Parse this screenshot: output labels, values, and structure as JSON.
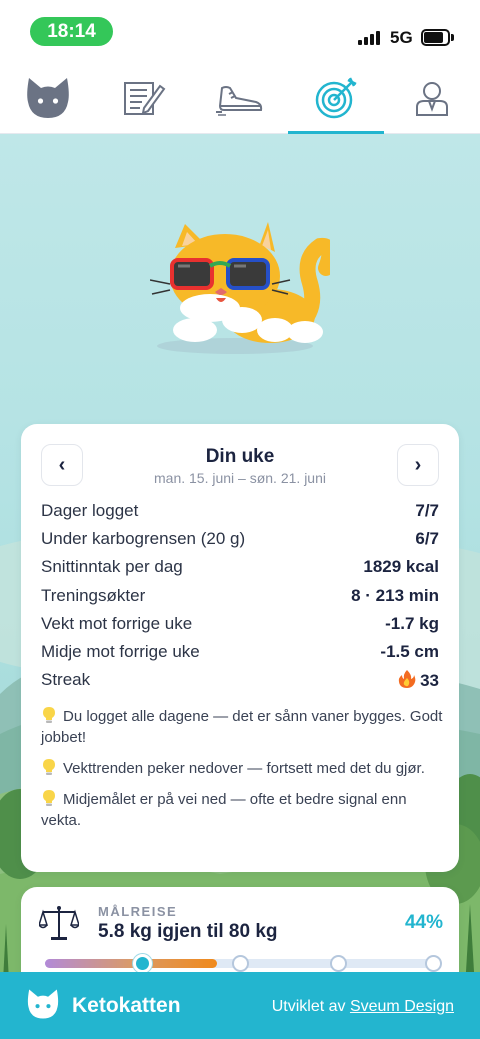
{
  "status_bar": {
    "time": "18:14",
    "network": "5G"
  },
  "nav": {
    "items": [
      {
        "name": "profile-cat",
        "icon": "cat-face-icon"
      },
      {
        "name": "diary",
        "icon": "notebook-pencil-icon"
      },
      {
        "name": "training",
        "icon": "sneaker-icon"
      },
      {
        "name": "goals",
        "icon": "target-icon",
        "active": true
      },
      {
        "name": "account",
        "icon": "person-icon"
      }
    ]
  },
  "week": {
    "title": "Din uke",
    "range": "man. 15. juni – søn. 21. juni",
    "prev_label": "‹",
    "next_label": "›",
    "stats": [
      {
        "label": "Dager logget",
        "value": "7/7"
      },
      {
        "label": "Under karbogrensen (20 g)",
        "value": "6/7"
      },
      {
        "label": "Snittinntak per dag",
        "value": "1829 kcal"
      },
      {
        "label": "Treningsøkter",
        "value": "8 · 213 min"
      },
      {
        "label": "Vekt mot forrige uke",
        "value": "-1.7 kg"
      },
      {
        "label": "Midje mot forrige uke",
        "value": "-1.5 cm"
      },
      {
        "label": "Streak",
        "value": "33",
        "icon": "fire-icon"
      }
    ],
    "tips": [
      "Du logget alle dagene — det er sånn vaner bygges. Godt jobbet!",
      "Vekttrenden peker nedover — fortsett med det du gjør.",
      "Midjemålet er på vei ned — ofte et bedre signal enn vekta."
    ]
  },
  "goal": {
    "eyebrow": "MÅLREISE",
    "title": "5.8 kg igjen til 80 kg",
    "percent": "44%",
    "progress_fraction": 0.44,
    "milestone_fractions": [
      0.25,
      0.5,
      0.75,
      1.0
    ],
    "current_milestone_index": 0
  },
  "footer": {
    "brand": "Ketokatten",
    "credit_prefix": "Utviklet av",
    "credit_link": "Sveum Design"
  },
  "colors": {
    "accent": "#23b5cf",
    "status_green": "#34c759",
    "text_dark": "#1c2440",
    "text_muted": "#8b92a3"
  }
}
